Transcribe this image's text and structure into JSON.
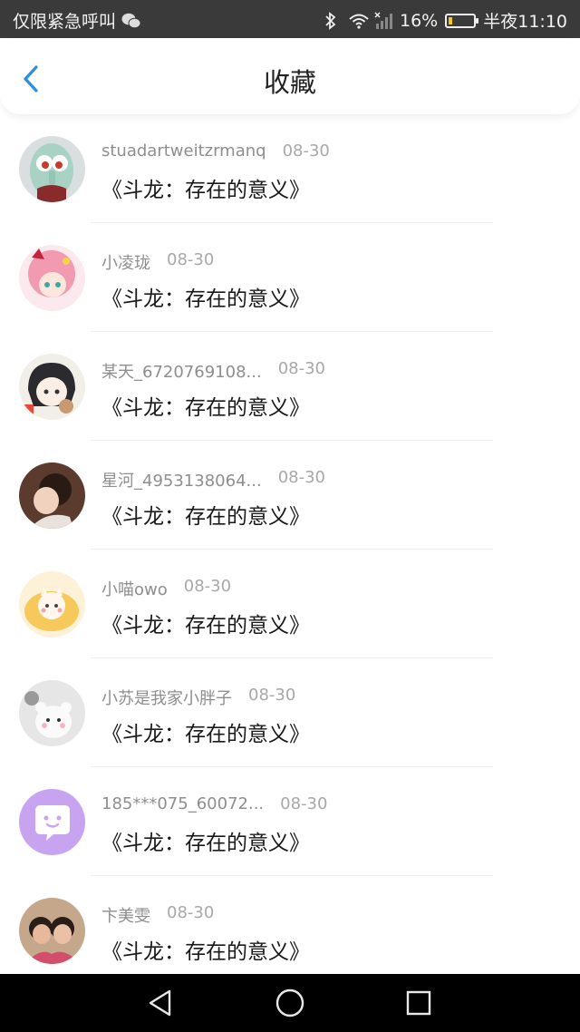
{
  "status_bar": {
    "carrier": "仅限紧急呼叫",
    "battery_percent": "16%",
    "time": "半夜11:10",
    "battery_level": 0.16,
    "icons": [
      "wechat-icon",
      "bluetooth-icon",
      "wifi-icon",
      "signal-icon",
      "battery-icon"
    ]
  },
  "header": {
    "title": "收藏",
    "back_icon": "chevron-left-icon"
  },
  "accent_color": "#2a8fe0",
  "items": [
    {
      "user": "stuadartweitzrmanq",
      "date": "08-30",
      "book": "《斗龙：存在的意义》"
    },
    {
      "user": "小凌珑",
      "date": "08-30",
      "book": "《斗龙：存在的意义》"
    },
    {
      "user": "某天_6720769108...",
      "date": "08-30",
      "book": "《斗龙：存在的意义》"
    },
    {
      "user": "星河_4953138064...",
      "date": "08-30",
      "book": "《斗龙：存在的意义》"
    },
    {
      "user": "小喵owo",
      "date": "08-30",
      "book": "《斗龙：存在的意义》"
    },
    {
      "user": "小苏是我家小胖子",
      "date": "08-30",
      "book": "《斗龙：存在的意义》"
    },
    {
      "user": "185***075_60072...",
      "date": "08-30",
      "book": "《斗龙：存在的意义》"
    },
    {
      "user": "卞美雯",
      "date": "08-30",
      "book": "《斗龙：存在的意义》"
    }
  ],
  "nav_bar": {
    "icons": [
      "back-triangle-icon",
      "home-circle-icon",
      "recents-square-icon"
    ]
  }
}
